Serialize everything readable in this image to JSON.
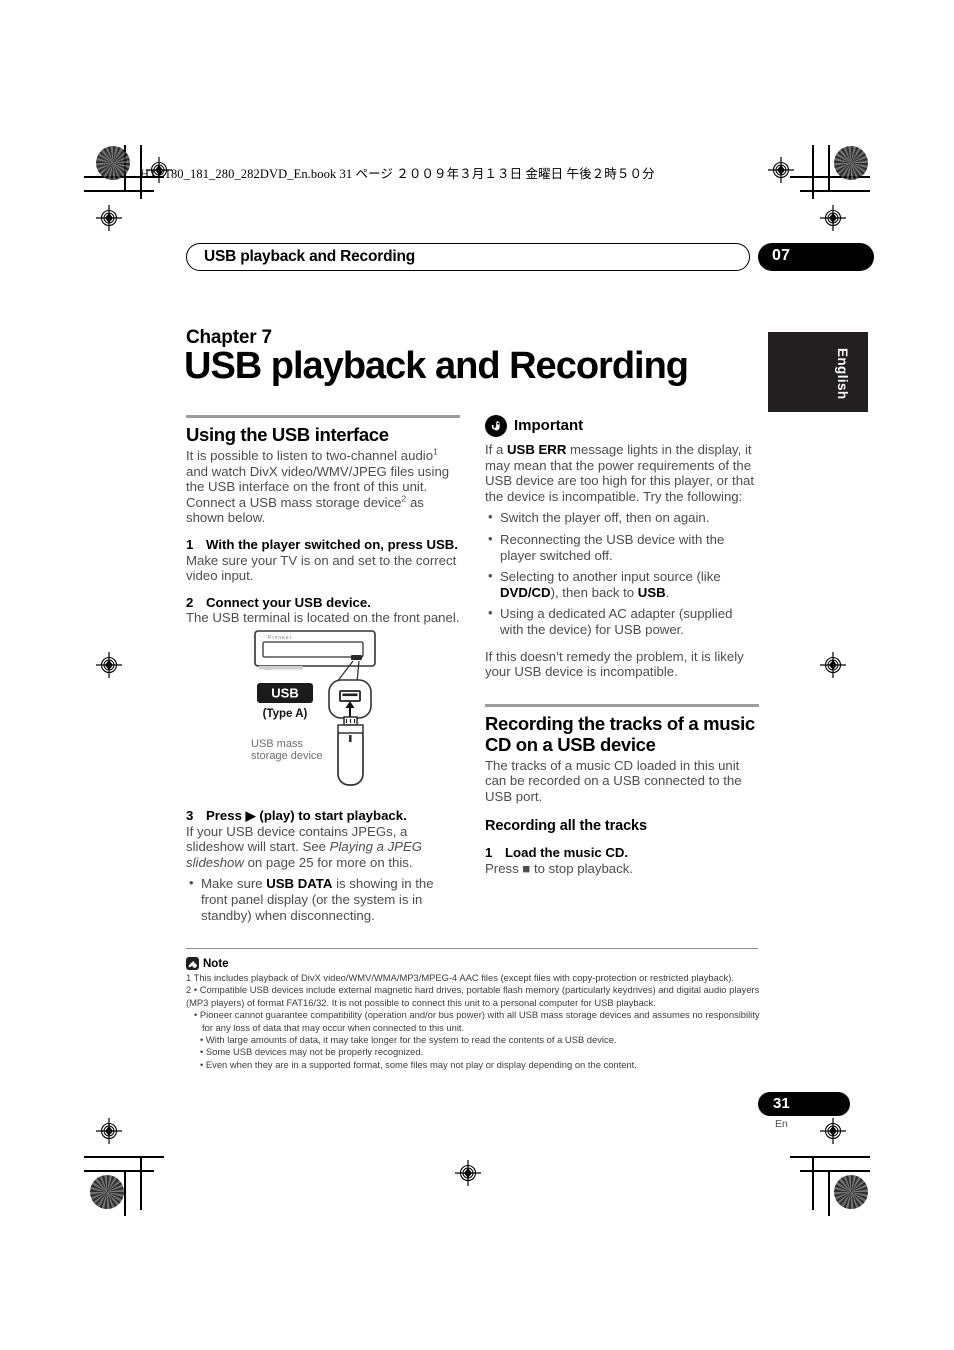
{
  "print_header": "HTZ180_181_280_282DVD_En.book  31 ページ  ２００９年３月１３日  金曜日  午後２時５０分",
  "running_head": {
    "title": "USB playback and Recording",
    "chapter_number": "07"
  },
  "language_tab": "English",
  "chapter": {
    "label": "Chapter 7",
    "title": "USB playback and Recording"
  },
  "left_column": {
    "section_heading": "Using the USB interface",
    "intro_1": "It is possible to listen to two-channel audio",
    "intro_sup_1": "1",
    "intro_2": " and watch DivX video/WMV/JPEG files using the USB interface on the front of this unit. Connect a USB mass storage device",
    "intro_sup_2": "2",
    "intro_3": " as shown below.",
    "steps": [
      {
        "num": "1",
        "head": "With the player switched on, press USB.",
        "body": "Make sure your TV is on and set to the correct video input."
      },
      {
        "num": "2",
        "head": "Connect your USB device.",
        "body": "The USB terminal is located on the front panel."
      }
    ],
    "step3": {
      "num": "3",
      "head_pre": "Press ",
      "head_glyph": "▶",
      "head_post": " (play) to start playback.",
      "body_1": "If your USB device contains JPEGs, a slideshow will start. See ",
      "body_italic": "Playing a JPEG slideshow",
      "body_2": " on page 25 for more on this.",
      "bullet_1a": "Make sure ",
      "bullet_1b": "USB DATA",
      "bullet_1c": " is showing in the front panel display (or the system is in standby) when disconnecting."
    },
    "diagram": {
      "brand": "Pioneer",
      "usb_badge": "USB",
      "type_label": "(Type A)",
      "device_label_1": "USB mass",
      "device_label_2": "storage device"
    }
  },
  "right_column": {
    "important": {
      "icon": "hand-pointer-icon",
      "label": "Important",
      "intro_1": "If a ",
      "intro_bold": "USB ERR",
      "intro_2": " message lights in the display, it may mean that the power requirements of the USB device are too high for this player, or that the device is incompatible. Try the following:",
      "bullets": [
        {
          "text": "Switch the player off, then on again."
        },
        {
          "text": "Reconnecting the USB device with the player switched off."
        },
        {
          "pre": "Selecting to another input source (like ",
          "bold1": "DVD/CD",
          "mid": "), then back to ",
          "bold2": "USB",
          "post": "."
        },
        {
          "text": "Using a dedicated AC adapter (supplied with the device) for USB power."
        }
      ],
      "closing": "If this doesn’t remedy the problem, it is likely your USB device is incompatible."
    },
    "recording": {
      "section_heading": "Recording the tracks of a music CD on a USB device",
      "intro": "The tracks of a music CD loaded in this unit can be recorded on a USB connected to the USB port.",
      "sub_heading": "Recording all the tracks",
      "step": {
        "num": "1",
        "head": "Load the music CD.",
        "body_pre": "Press ",
        "body_glyph": "■",
        "body_post": " to stop playback."
      }
    }
  },
  "note": {
    "icon": "note-pencil-icon",
    "label": "Note",
    "lines": [
      "1 This includes playback of DivX video/WMV/WMA/MP3/MPEG-4 AAC files (except files with copy-protection or restricted playback).",
      "2 • Compatible USB devices include external magnetic hard drives, portable flash memory (particularly keydrives) and digital audio players (MP3 players) of format FAT16/32. It is not possible to connect this unit to a personal computer for USB playback.",
      "• Pioneer cannot guarantee compatibility (operation and/or bus power) with all USB mass storage devices and assumes no responsibility for any loss of data that may occur when connected to this unit.",
      "• With large amounts of data, it may take longer for the system to read the contents of a USB device.",
      "• Some USB devices may not be properly recognized.",
      "• Even when they are in a supported format, some files may not play or display depending on the content."
    ]
  },
  "page_footer": {
    "number": "31",
    "language": "En"
  }
}
